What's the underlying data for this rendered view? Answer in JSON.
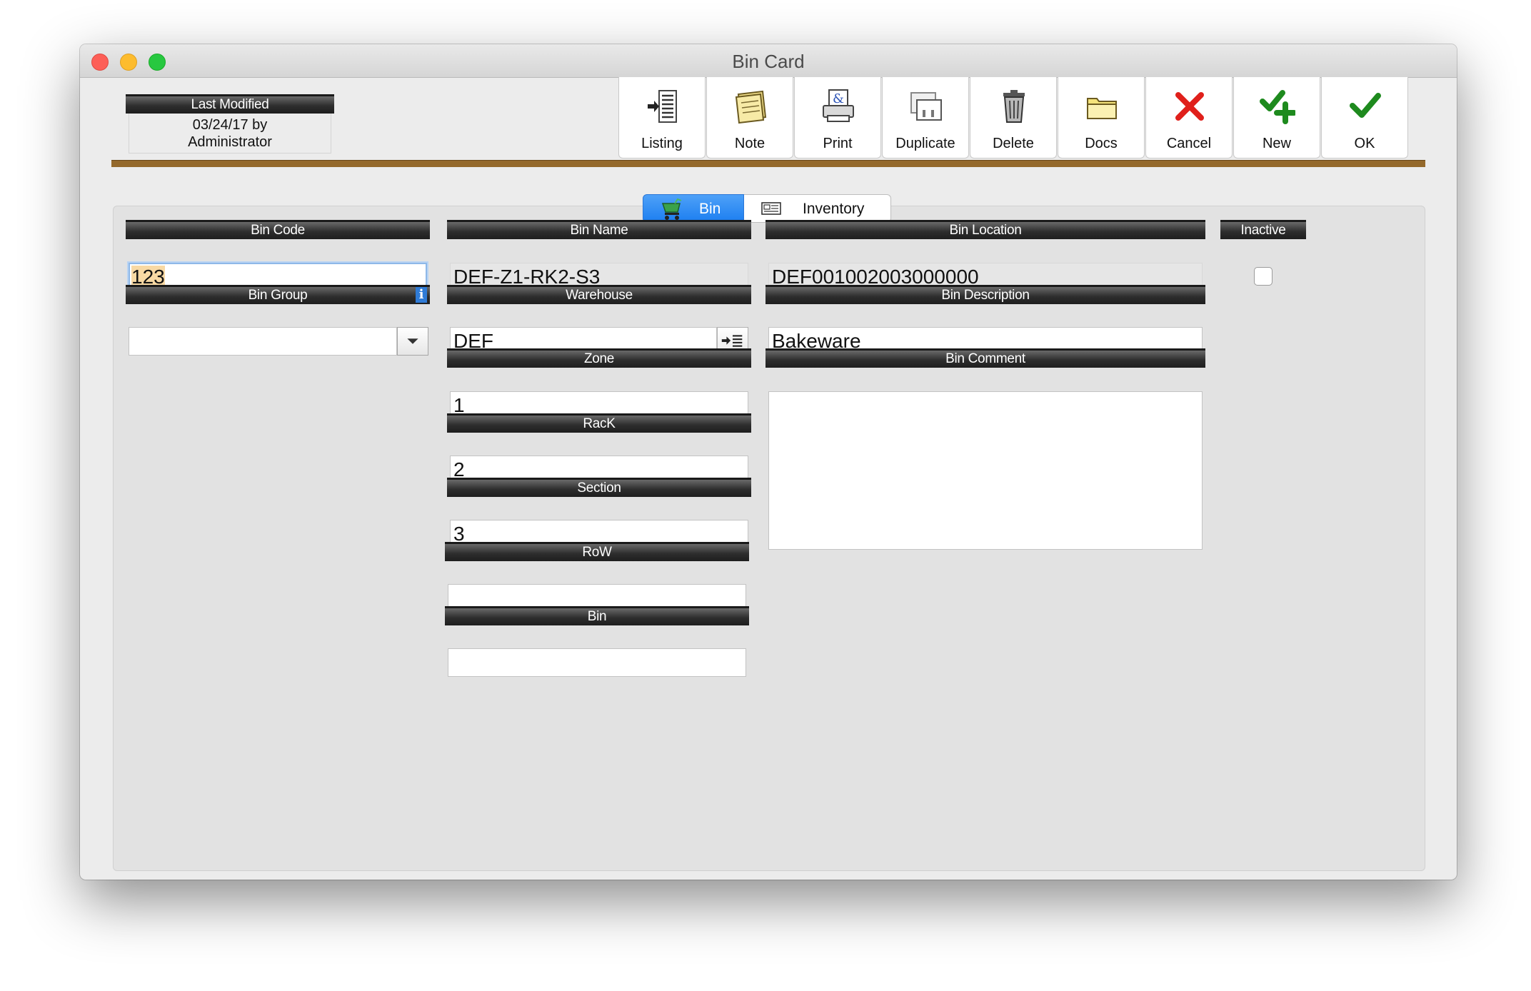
{
  "window": {
    "title": "Bin Card"
  },
  "last_modified": {
    "label": "Last Modified",
    "date_line": "03/24/17 by",
    "user": "Administrator"
  },
  "toolbar": {
    "buttons": [
      {
        "label": "Listing",
        "icon": "listing-icon"
      },
      {
        "label": "Note",
        "icon": "note-icon"
      },
      {
        "label": "Print",
        "icon": "print-icon"
      },
      {
        "label": "Duplicate",
        "icon": "duplicate-icon"
      },
      {
        "label": "Delete",
        "icon": "trash-icon"
      },
      {
        "label": "Docs",
        "icon": "folder-icon"
      },
      {
        "label": "Cancel",
        "icon": "x-icon"
      },
      {
        "label": "New",
        "icon": "check-plus-icon"
      },
      {
        "label": "OK",
        "icon": "check-icon"
      }
    ]
  },
  "tabs": [
    {
      "label": "Bin",
      "active": true,
      "icon": "cart-icon"
    },
    {
      "label": "Inventory",
      "active": false,
      "icon": "item-tag-icon"
    }
  ],
  "fields": {
    "bin_code": {
      "label": "Bin Code",
      "value": "123"
    },
    "bin_name": {
      "label": "Bin Name",
      "value": "DEF-Z1-RK2-S3"
    },
    "bin_location": {
      "label": "Bin Location",
      "value": "DEF001002003000000"
    },
    "inactive": {
      "label": "Inactive",
      "checked": false
    },
    "bin_group": {
      "label": "Bin Group",
      "value": ""
    },
    "warehouse": {
      "label": "Warehouse",
      "value": "DEF"
    },
    "bin_description": {
      "label": "Bin Description",
      "value": "Bakeware"
    },
    "zone": {
      "label": "Zone",
      "value": "1"
    },
    "rack": {
      "label": "RacK",
      "value": "2"
    },
    "section": {
      "label": "Section",
      "value": "3"
    },
    "row": {
      "label": "RoW",
      "value": ""
    },
    "bin": {
      "label": "Bin",
      "value": ""
    },
    "bin_comment": {
      "label": "Bin Comment",
      "value": ""
    }
  },
  "colors": {
    "accent_line": "#94692b",
    "active_tab": "#1c7ef0",
    "cancel_red": "#e0201b",
    "ok_green": "#1e8a1e"
  }
}
